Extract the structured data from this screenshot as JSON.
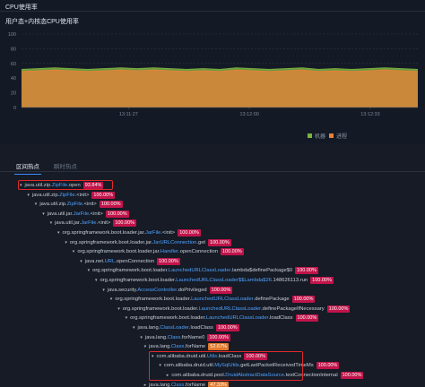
{
  "panel_title": "CPU使用率",
  "chart": {
    "title": "用户态+内核态CPU使用率",
    "colors": {
      "machine": "#7cb342",
      "process": "#e8813a",
      "grid": "#2c3442"
    },
    "legend": [
      {
        "label": "机器",
        "color": "#7cb342"
      },
      {
        "label": "进程",
        "color": "#e8813a"
      }
    ]
  },
  "chart_data": {
    "type": "area",
    "title": "用户态+内核态CPU使用率",
    "ylim": [
      0,
      100
    ],
    "yticks": [
      "100",
      "80",
      "60",
      "40",
      "20",
      "0"
    ],
    "x": [
      "13:11:27",
      "13:12:00",
      "13:12:33"
    ],
    "series": [
      {
        "name": "机器",
        "values": [
          52,
          53,
          54,
          53,
          52,
          53,
          54,
          53,
          54,
          53,
          52,
          53,
          52,
          54,
          53,
          52,
          53,
          54,
          52,
          53,
          52,
          53,
          54,
          53,
          52
        ]
      },
      {
        "name": "进程",
        "values": [
          49,
          50,
          51,
          50,
          49,
          50,
          51,
          50,
          51,
          50,
          49,
          50,
          49,
          51,
          50,
          49,
          50,
          51,
          49,
          50,
          49,
          50,
          51,
          50,
          49
        ]
      }
    ],
    "grid": true,
    "legend_position": "bottom-right"
  },
  "tabs": [
    {
      "label": "区间热点",
      "active": true
    },
    {
      "label": "瞬时热点",
      "active": false
    }
  ],
  "tree": [
    {
      "prefix": "java.util.zip.",
      "hl": "ZipFile",
      "suffix": ".open",
      "badge": "93.84%",
      "caret": "▾"
    },
    {
      "prefix": "java.util.zip.",
      "hl": "ZipFile",
      "suffix": ".<init>",
      "badge": "100.00%",
      "caret": "▾"
    },
    {
      "prefix": "java.util.zip.",
      "hl": "ZipFile",
      "suffix": ".<init>",
      "badge": "100.00%",
      "caret": "▾"
    },
    {
      "prefix": "java.util.jar.",
      "hl": "JarFile",
      "suffix": ".<init>",
      "badge": "100.00%",
      "caret": "▾"
    },
    {
      "prefix": "java.util.jar.",
      "hl": "JarFile",
      "suffix": ".<init>",
      "badge": "100.00%",
      "caret": "▾"
    },
    {
      "prefix": "org.springframework.boot.loader.jar.",
      "hl": "JarFile",
      "suffix": ".<init>",
      "badge": "100.00%",
      "caret": "▾"
    },
    {
      "prefix": "org.springframework.boot.loader.jar.",
      "hl": "JarURLConnection",
      "suffix": ".get",
      "badge": "100.00%",
      "caret": "▾"
    },
    {
      "prefix": "org.springframework.boot.loader.jar.",
      "hl": "Handler",
      "suffix": ".openConnection",
      "badge": "100.00%",
      "caret": "▾"
    },
    {
      "prefix": "java.net.",
      "hl": "URL",
      "suffix": ".openConnection",
      "badge": "100.00%",
      "caret": "▾"
    },
    {
      "prefix": "org.springframework.boot.loader.",
      "hl": "LaunchedURLClassLoader",
      "suffix": ".lambda$definePackage$0",
      "badge": "100.00%",
      "caret": "▾"
    },
    {
      "prefix": "org.springframework.boot.loader.",
      "hl": "LaunchedURLClassLoader$$Lambda$26",
      "suffix": ".148626113.run",
      "badge": "100.00%",
      "caret": "▾"
    },
    {
      "prefix": "java.security.",
      "hl": "AccessController",
      "suffix": ".doPrivileged",
      "badge": "100.00%",
      "caret": "▾"
    },
    {
      "prefix": "org.springframework.boot.loader.",
      "hl": "LaunchedURLClassLoader",
      "suffix": ".definePackage",
      "badge": "100.00%",
      "caret": "▾"
    },
    {
      "prefix": "org.springframework.boot.loader.",
      "hl": "LaunchedURLClassLoader",
      "suffix": ".definePackageIfNecessary",
      "badge": "100.00%",
      "caret": "▾"
    },
    {
      "prefix": "org.springframework.boot.loader.",
      "hl": "LaunchedURLClassLoader",
      "suffix": ".loadClass",
      "badge": "100.00%",
      "caret": "▾"
    },
    {
      "prefix": "java.lang.",
      "hl": "ClassLoader",
      "suffix": ".loadClass",
      "badge": "100.00%",
      "caret": "▾"
    },
    {
      "prefix": "java.lang.",
      "hl": "Class",
      "suffix": ".forName0",
      "badge": "100.00%",
      "caret": "▾"
    },
    {
      "prefix": "java.lang.",
      "hl": "Class",
      "suffix": ".forName",
      "badge": "52.67%",
      "caret": "▾",
      "badge_color": "orange"
    },
    {
      "prefix": "com.alibaba.druid.util.",
      "hl": "Utils",
      "suffix": ".loadClass",
      "badge": "100.00%",
      "caret": "▾"
    },
    {
      "prefix": "com.alibaba.druid.util.",
      "hl": "MySqlUtils",
      "suffix": ".getLastPacketReceivedTimeMs",
      "badge": "100.00%",
      "caret": "▾"
    },
    {
      "prefix": "com.alibaba.druid.pool.",
      "hl": "DruidAbstractDataSource",
      "suffix": ".testConnectionInternal",
      "badge": "100.00%",
      "caret": "▸"
    },
    {
      "prefix": "java.lang.",
      "hl": "Class",
      "suffix": ".forName",
      "badge": "47.33%",
      "caret": "▸",
      "badge_color": "orange"
    }
  ]
}
